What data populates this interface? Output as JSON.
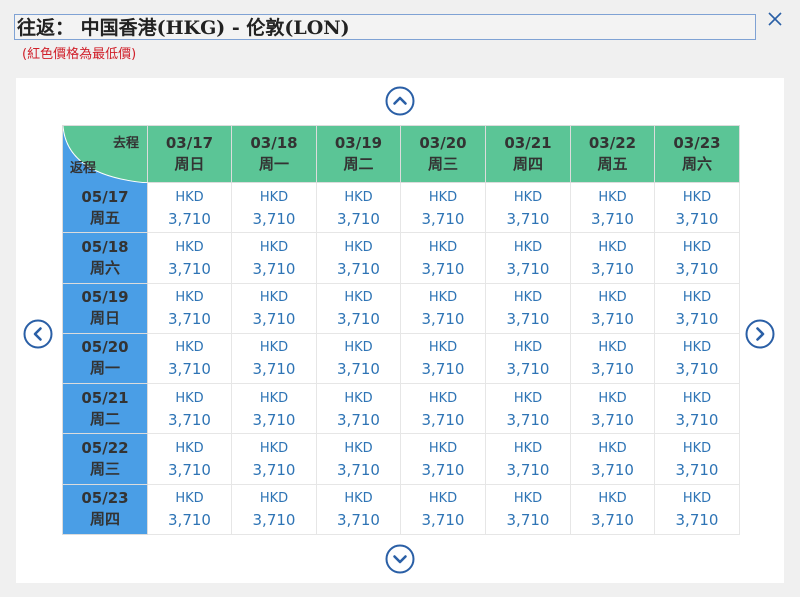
{
  "header": {
    "title": "往返： 中国香港(HKG) - 伦敦(LON)",
    "note": "(紅色價格為最低價)"
  },
  "grid": {
    "corner_out": "去程",
    "corner_return": "返程",
    "outbound": [
      {
        "date": "03/17",
        "day": "周日"
      },
      {
        "date": "03/18",
        "day": "周一"
      },
      {
        "date": "03/19",
        "day": "周二"
      },
      {
        "date": "03/20",
        "day": "周三"
      },
      {
        "date": "03/21",
        "day": "周四"
      },
      {
        "date": "03/22",
        "day": "周五"
      },
      {
        "date": "03/23",
        "day": "周六"
      }
    ],
    "returns": [
      {
        "date": "05/17",
        "day": "周五",
        "prices": [
          {
            "cur": "HKD",
            "amt": "3,710"
          },
          {
            "cur": "HKD",
            "amt": "3,710"
          },
          {
            "cur": "HKD",
            "amt": "3,710"
          },
          {
            "cur": "HKD",
            "amt": "3,710"
          },
          {
            "cur": "HKD",
            "amt": "3,710"
          },
          {
            "cur": "HKD",
            "amt": "3,710"
          },
          {
            "cur": "HKD",
            "amt": "3,710"
          }
        ]
      },
      {
        "date": "05/18",
        "day": "周六",
        "prices": [
          {
            "cur": "HKD",
            "amt": "3,710"
          },
          {
            "cur": "HKD",
            "amt": "3,710"
          },
          {
            "cur": "HKD",
            "amt": "3,710"
          },
          {
            "cur": "HKD",
            "amt": "3,710"
          },
          {
            "cur": "HKD",
            "amt": "3,710"
          },
          {
            "cur": "HKD",
            "amt": "3,710"
          },
          {
            "cur": "HKD",
            "amt": "3,710"
          }
        ]
      },
      {
        "date": "05/19",
        "day": "周日",
        "prices": [
          {
            "cur": "HKD",
            "amt": "3,710"
          },
          {
            "cur": "HKD",
            "amt": "3,710"
          },
          {
            "cur": "HKD",
            "amt": "3,710"
          },
          {
            "cur": "HKD",
            "amt": "3,710"
          },
          {
            "cur": "HKD",
            "amt": "3,710"
          },
          {
            "cur": "HKD",
            "amt": "3,710"
          },
          {
            "cur": "HKD",
            "amt": "3,710"
          }
        ]
      },
      {
        "date": "05/20",
        "day": "周一",
        "prices": [
          {
            "cur": "HKD",
            "amt": "3,710"
          },
          {
            "cur": "HKD",
            "amt": "3,710"
          },
          {
            "cur": "HKD",
            "amt": "3,710"
          },
          {
            "cur": "HKD",
            "amt": "3,710"
          },
          {
            "cur": "HKD",
            "amt": "3,710"
          },
          {
            "cur": "HKD",
            "amt": "3,710"
          },
          {
            "cur": "HKD",
            "amt": "3,710"
          }
        ]
      },
      {
        "date": "05/21",
        "day": "周二",
        "prices": [
          {
            "cur": "HKD",
            "amt": "3,710"
          },
          {
            "cur": "HKD",
            "amt": "3,710"
          },
          {
            "cur": "HKD",
            "amt": "3,710"
          },
          {
            "cur": "HKD",
            "amt": "3,710"
          },
          {
            "cur": "HKD",
            "amt": "3,710"
          },
          {
            "cur": "HKD",
            "amt": "3,710"
          },
          {
            "cur": "HKD",
            "amt": "3,710"
          }
        ]
      },
      {
        "date": "05/22",
        "day": "周三",
        "prices": [
          {
            "cur": "HKD",
            "amt": "3,710"
          },
          {
            "cur": "HKD",
            "amt": "3,710"
          },
          {
            "cur": "HKD",
            "amt": "3,710"
          },
          {
            "cur": "HKD",
            "amt": "3,710"
          },
          {
            "cur": "HKD",
            "amt": "3,710"
          },
          {
            "cur": "HKD",
            "amt": "3,710"
          },
          {
            "cur": "HKD",
            "amt": "3,710"
          }
        ]
      },
      {
        "date": "05/23",
        "day": "周四",
        "prices": [
          {
            "cur": "HKD",
            "amt": "3,710"
          },
          {
            "cur": "HKD",
            "amt": "3,710"
          },
          {
            "cur": "HKD",
            "amt": "3,710"
          },
          {
            "cur": "HKD",
            "amt": "3,710"
          },
          {
            "cur": "HKD",
            "amt": "3,710"
          },
          {
            "cur": "HKD",
            "amt": "3,710"
          },
          {
            "cur": "HKD",
            "amt": "3,710"
          }
        ]
      }
    ]
  },
  "icons": {
    "close": "close-icon",
    "up": "chevron-up-circle-icon",
    "down": "chevron-down-circle-icon",
    "left": "chevron-left-circle-icon",
    "right": "chevron-right-circle-icon"
  },
  "colors": {
    "outbound_header": "#5bc596",
    "return_header": "#4a9ee6",
    "price_text": "#2e74b5",
    "note_text": "#d0202a",
    "nav_icon": "#2a5fa6"
  }
}
